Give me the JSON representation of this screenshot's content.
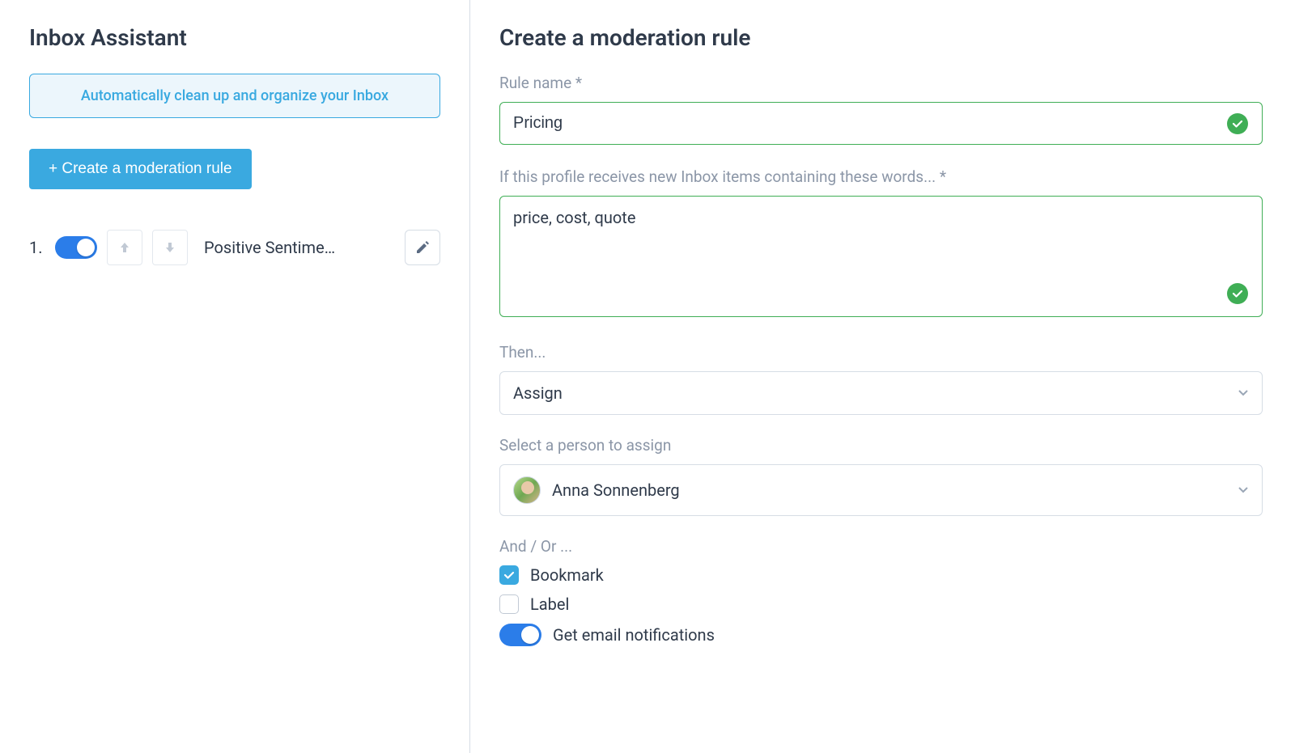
{
  "left": {
    "title": "Inbox Assistant",
    "banner": "Automatically clean up and organize your Inbox",
    "create_btn": "+ Create a moderation rule",
    "rules": [
      {
        "index": "1.",
        "name": "Positive Sentime…",
        "enabled": true
      }
    ]
  },
  "right": {
    "title": "Create a moderation rule",
    "rule_name_label": "Rule name *",
    "rule_name_value": "Pricing",
    "keywords_label": "If this profile receives new Inbox items containing these words... *",
    "keywords_value": "price, cost, quote",
    "then_label": "Then...",
    "then_value": "Assign",
    "assign_label": "Select a person to assign",
    "assign_value": "Anna Sonnenberg",
    "andor_label": "And / Or ...",
    "bookmark_label": "Bookmark",
    "label_label": "Label",
    "notif_label": "Get email notifications",
    "bookmark_checked": true,
    "label_checked": false,
    "notif_enabled": true
  }
}
